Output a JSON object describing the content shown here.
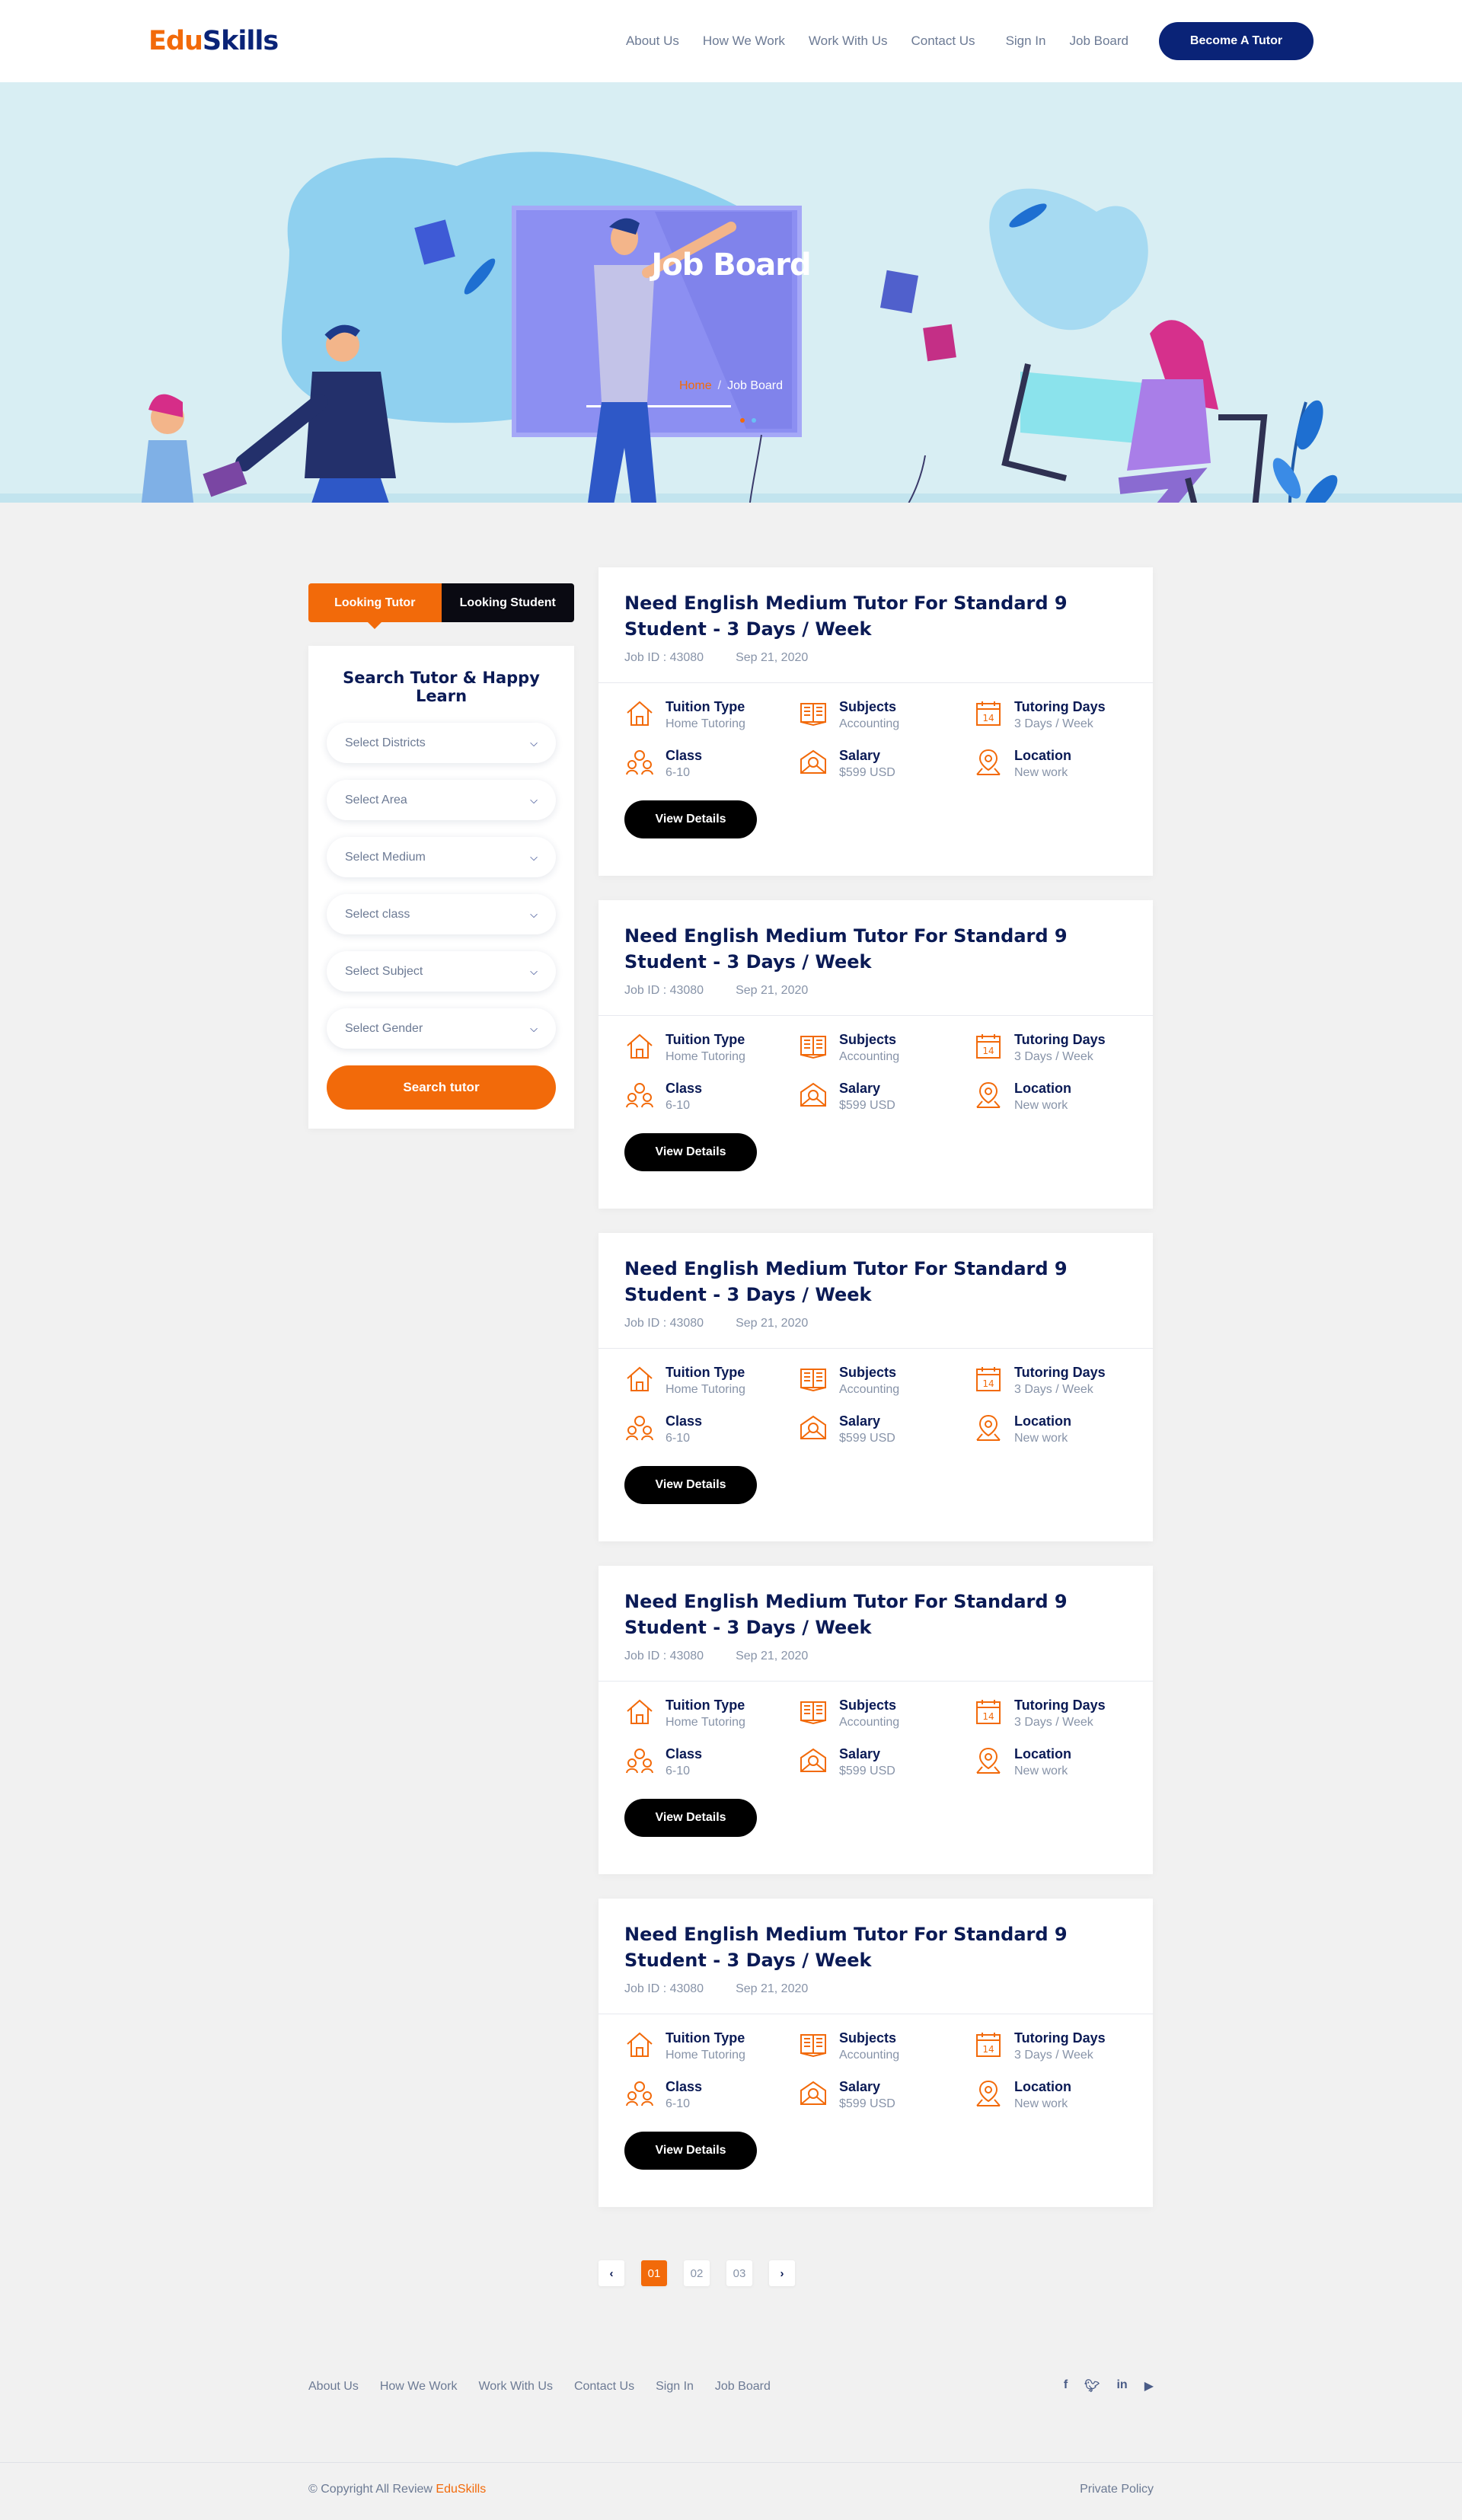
{
  "header": {
    "logo_a": "Edu",
    "logo_b": "Skills",
    "nav": [
      "About Us",
      "How We Work",
      "Work With Us",
      "Contact Us",
      "Sign In",
      "Job Board"
    ],
    "cta": "Become A Tutor"
  },
  "hero": {
    "title": "Job Board",
    "crumb_home": "Home",
    "crumb_sep": "/",
    "crumb_current": "Job Board"
  },
  "sidebar": {
    "tab_active": "Looking Tutor",
    "tab_other": "Looking Student",
    "heading": "Search Tutor & Happy Learn",
    "selects": [
      "Select Districts",
      "Select Area",
      "Select Medium",
      "Select class",
      "Select Subject",
      "Select Gender"
    ],
    "button": "Search tutor"
  },
  "job": {
    "title": "Need English Medium Tutor For Standard 9 Student - 3 Days / Week",
    "job_id": "Job ID : 43080",
    "date": "Sep 21, 2020",
    "fields": [
      {
        "label": "Tuition Type",
        "value": "Home Tutoring",
        "icon": "home-icon"
      },
      {
        "label": "Subjects",
        "value": "Accounting",
        "icon": "book-icon"
      },
      {
        "label": "Tutoring Days",
        "value": "3 Days / Week",
        "icon": "calendar-icon"
      },
      {
        "label": "Class",
        "value": "6-10",
        "icon": "students-icon"
      },
      {
        "label": "Salary",
        "value": "$599 USD",
        "icon": "salary-icon"
      },
      {
        "label": "Location",
        "value": "New work",
        "icon": "location-icon"
      }
    ],
    "button": "View Details"
  },
  "pagination": [
    "01",
    "02",
    "03"
  ],
  "footer": {
    "nav": [
      "About Us",
      "How We Work",
      "Work With Us",
      "Contact Us",
      "Sign In",
      "Job Board"
    ],
    "social": [
      "f",
      "t",
      "in",
      "yt"
    ],
    "copyright": "© Copyright All Review",
    "brand": "EduSkills",
    "policy": "Private Policy"
  },
  "colors": {
    "accent": "#f26a0a",
    "navy": "#0a2377",
    "heading": "#0a1a55"
  }
}
